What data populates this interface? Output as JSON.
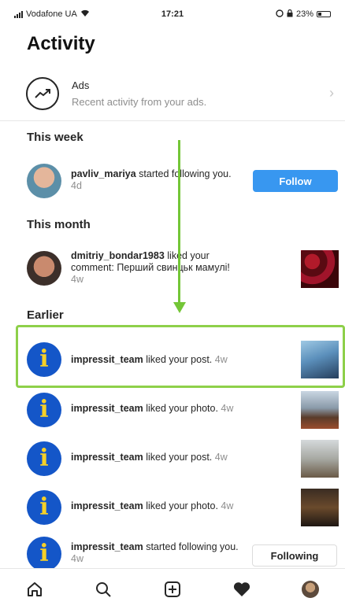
{
  "status_bar": {
    "carrier": "Vodafone UA",
    "time": "17:21",
    "battery": "23%"
  },
  "page_title": "Activity",
  "ads": {
    "title": "Ads",
    "subtitle": "Recent activity from your ads.",
    "icon": "trending-up-icon"
  },
  "sections": {
    "this_week": "This week",
    "this_month": "This month",
    "earlier": "Earlier"
  },
  "notifications": [
    {
      "user": "pavliv_mariya",
      "action": " started following you.",
      "time": " 4d",
      "action_button": "Follow"
    },
    {
      "user": "dmitriy_bondar1983",
      "action": " liked your comment: Перший свинцьк мамулі!",
      "time": " 4w"
    },
    {
      "user": "impressit_team",
      "action": " liked your post.",
      "time": " 4w"
    },
    {
      "user": "impressit_team",
      "action": " liked your photo.",
      "time": " 4w"
    },
    {
      "user": "impressit_team",
      "action": " liked your post.",
      "time": " 4w"
    },
    {
      "user": "impressit_team",
      "action": " liked your photo.",
      "time": " 4w"
    },
    {
      "user": "impressit_team",
      "action": " started following you.",
      "time": " 4w",
      "action_button": "Following"
    }
  ],
  "brand_avatar_glyph": "i",
  "colors": {
    "follow_blue": "#3897f0",
    "highlight_green": "#8ed04a",
    "brand_blue": "#1456c8",
    "brand_yellow": "#f5d028"
  },
  "tab_bar": {
    "icons": [
      "home-icon",
      "search-icon",
      "add-post-icon",
      "heart-icon",
      "profile-avatar"
    ]
  }
}
